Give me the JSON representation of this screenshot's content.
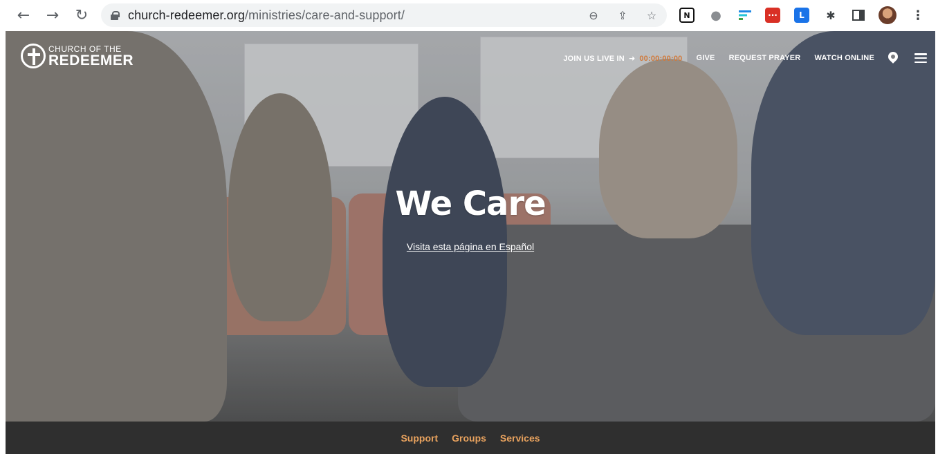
{
  "browser": {
    "url_domain": "church-redeemer.org",
    "url_path": "/ministries/care-and-support/",
    "back_icon": "arrow-left-icon",
    "forward_icon": "arrow-right-icon",
    "reload_icon": "reload-icon"
  },
  "site": {
    "logo_small": "CHURCH OF THE",
    "logo_big": "REDEEMER"
  },
  "topnav": {
    "join_label": "JOIN US LIVE IN",
    "live_label": "00:00:00:00",
    "give_label": "GIVE",
    "prayer_label": "REQUEST PRAYER",
    "watch_label": "WATCH ONLINE"
  },
  "hero": {
    "title": "We Care",
    "link": "Visita esta página en Español"
  },
  "subnav": {
    "items": [
      {
        "label": "Support"
      },
      {
        "label": "Groups"
      },
      {
        "label": "Services"
      }
    ]
  },
  "colors": {
    "accent": "#e8a25e",
    "subnav_bg": "#2f2f2f"
  }
}
